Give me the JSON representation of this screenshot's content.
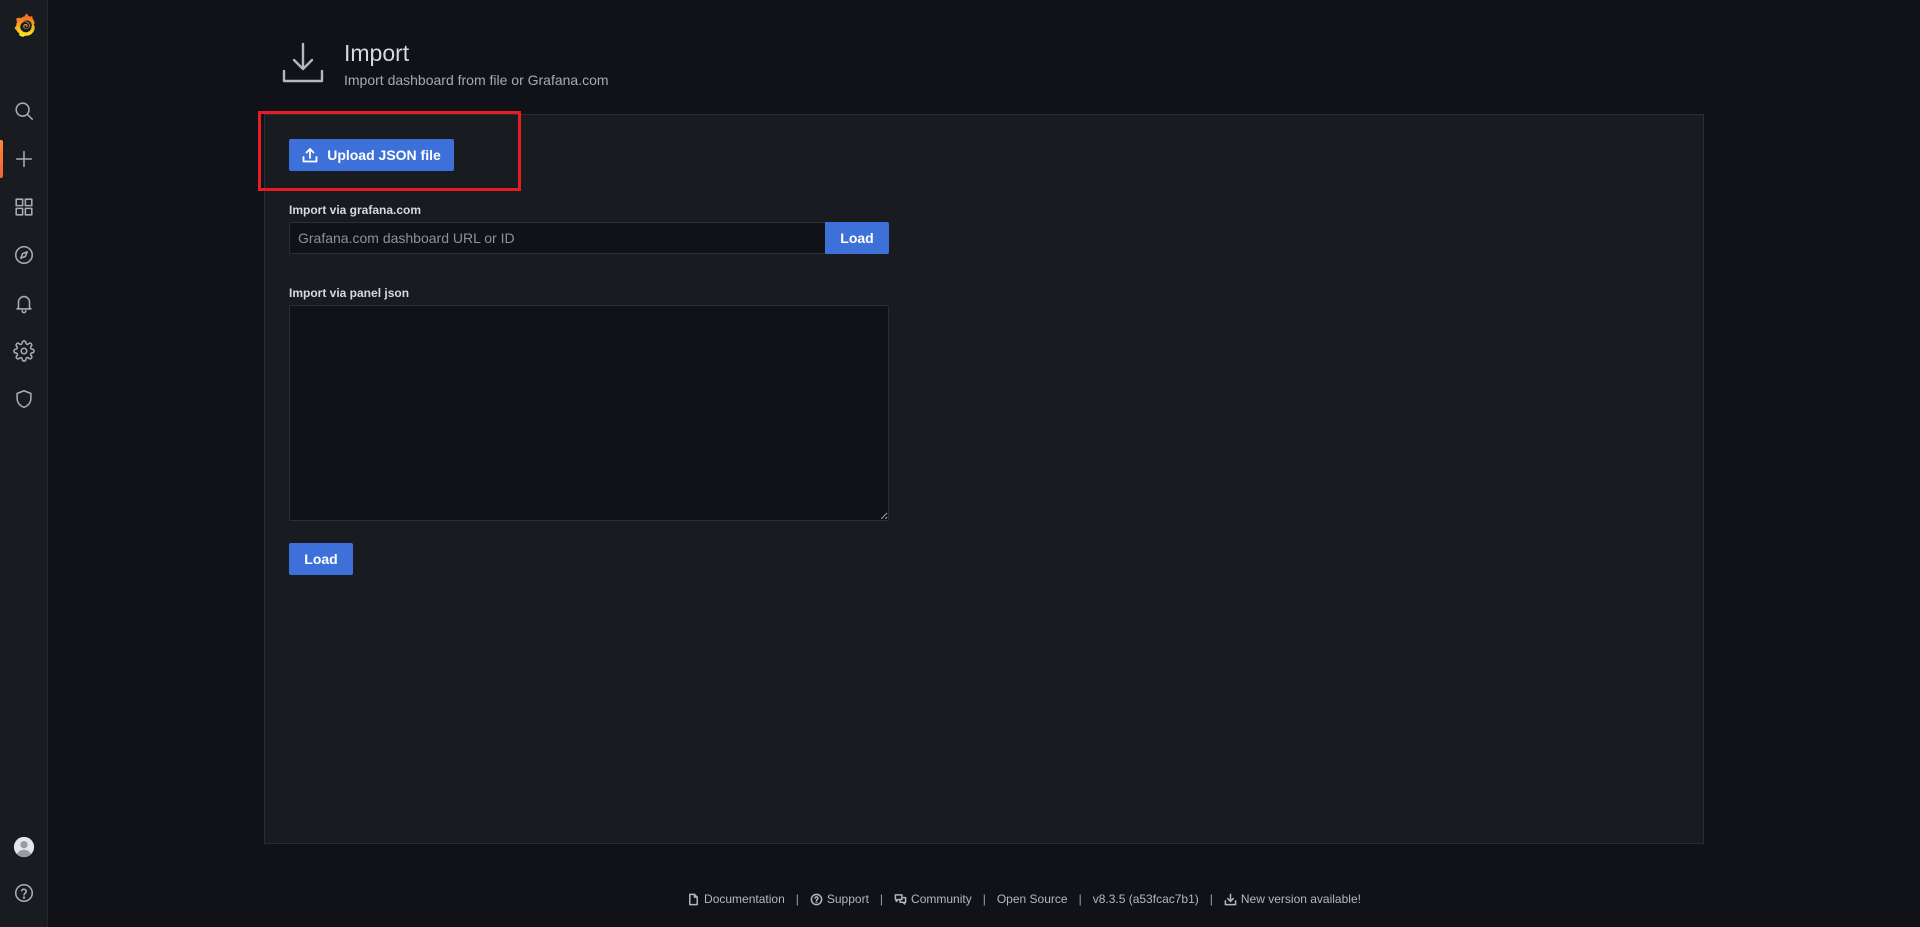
{
  "sidebar": {
    "items": [
      {
        "name": "grafana-logo",
        "icon": "grafana-logo-icon"
      },
      {
        "name": "search",
        "icon": "search-icon"
      },
      {
        "name": "create",
        "icon": "plus-icon",
        "active": true
      },
      {
        "name": "dashboards",
        "icon": "apps-icon"
      },
      {
        "name": "explore",
        "icon": "compass-icon"
      },
      {
        "name": "alerting",
        "icon": "bell-icon"
      },
      {
        "name": "configuration",
        "icon": "gear-icon"
      },
      {
        "name": "server-admin",
        "icon": "shield-icon"
      },
      {
        "name": "profile",
        "icon": "avatar-icon"
      },
      {
        "name": "help",
        "icon": "question-circle-icon"
      }
    ]
  },
  "header": {
    "title": "Import",
    "subtitle": "Import dashboard from file or Grafana.com",
    "icon": "import-download-icon"
  },
  "main": {
    "upload_button_label": "Upload JSON file",
    "grafana_label": "Import via grafana.com",
    "grafana_placeholder": "Grafana.com dashboard URL or ID",
    "grafana_load_label": "Load",
    "json_label": "Import via panel json",
    "json_value": "",
    "json_load_label": "Load"
  },
  "colors": {
    "primary_button": "#3d71d9",
    "highlight": "#e51c23",
    "accent": "#ff8833"
  },
  "footer": {
    "documentation": "Documentation",
    "support": "Support",
    "community": "Community",
    "open_source": "Open Source",
    "version": "v8.3.5 (a53fcac7b1)",
    "new_version": "New version available!",
    "separator": "|"
  }
}
